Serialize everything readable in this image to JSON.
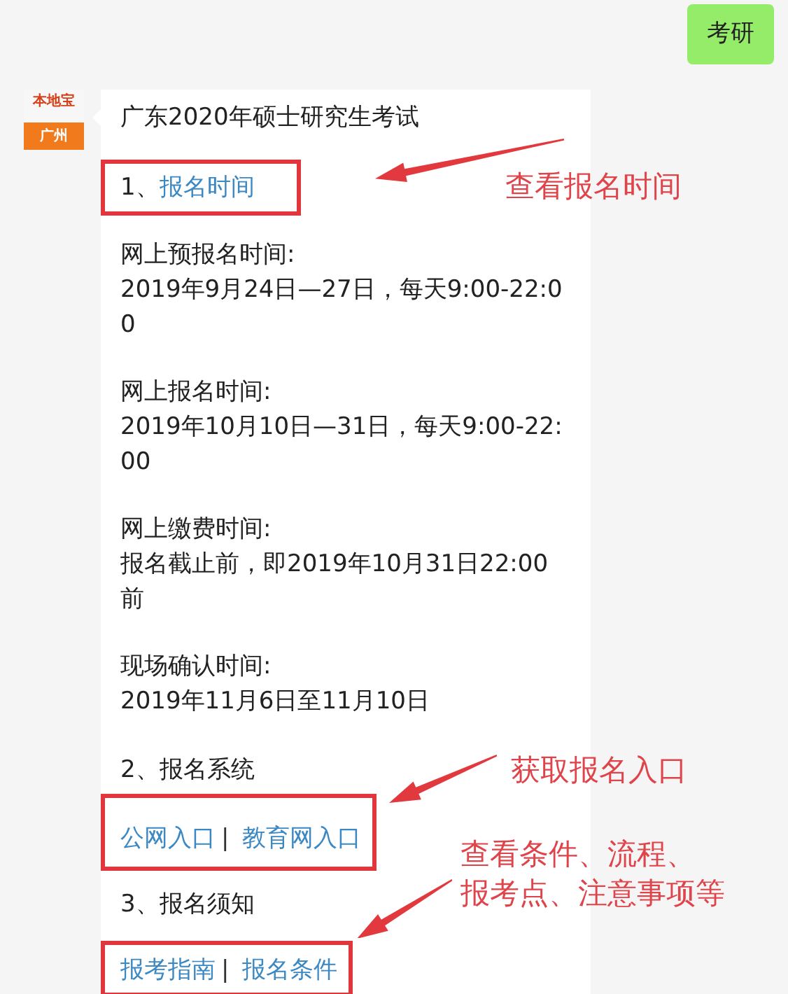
{
  "outgoing_message": {
    "text": "考研"
  },
  "incoming_message": {
    "avatar": {
      "brand": "本地宝",
      "city": "广州"
    },
    "title": "广东2020年硕士研究生考试",
    "items": [
      {
        "kind": "heading",
        "number": "1、",
        "link": "报名时间",
        "boxed": true,
        "annotation": [
          "查看报名时间"
        ]
      },
      {
        "kind": "entry",
        "label": "网上预报名时间:",
        "lines": [
          "2019年9月24日—27日，每天9:00-22:0",
          "0"
        ]
      },
      {
        "kind": "entry",
        "label": "网上报名时间:",
        "lines": [
          "2019年10月10日—31日，每天9:00-22:",
          "00"
        ]
      },
      {
        "kind": "entry",
        "label": "网上缴费时间:",
        "lines": [
          "报名截止前，即2019年10月31日22:00",
          "前"
        ]
      },
      {
        "kind": "entry",
        "label": "现场确认时间:",
        "lines": [
          "2019年11月6日至11月10日"
        ]
      },
      {
        "kind": "subheading",
        "text": "2、报名系统"
      },
      {
        "kind": "links",
        "links": [
          "公网入口",
          "教育网入口"
        ],
        "separator": "|",
        "boxed": true,
        "annotation": [
          "获取报名入口"
        ]
      },
      {
        "kind": "subheading",
        "text": "3、报名须知"
      },
      {
        "kind": "links",
        "links": [
          "报考指南",
          "报名条件"
        ],
        "separator": "|",
        "boxed": true,
        "annotation": [
          "查看条件、流程、",
          "报考点、注意事项等"
        ]
      }
    ]
  }
}
